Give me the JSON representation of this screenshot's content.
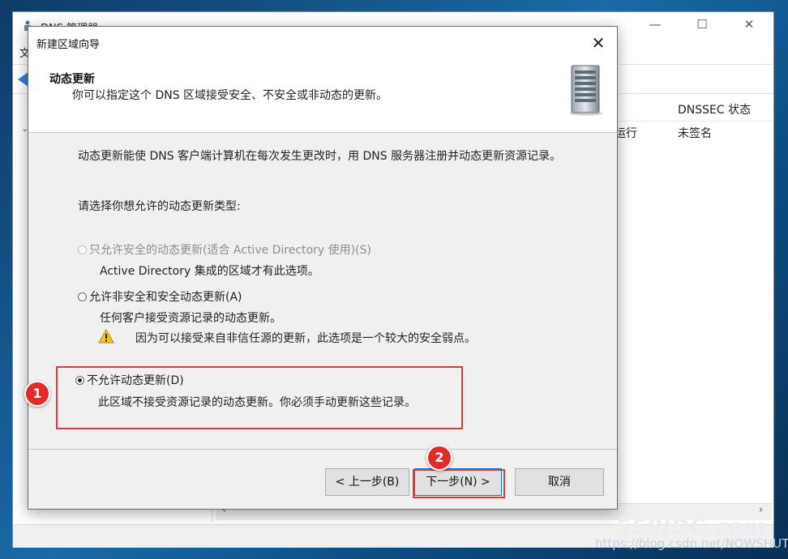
{
  "background_window": {
    "title": "DNS 管理器",
    "menu_first": "文",
    "column_dnssec": "DNSSEC 状态",
    "cell_status": "运行",
    "cell_dnssec": "未签名",
    "controls": {
      "minimize": "—",
      "maximize": "☐",
      "close": "✕"
    },
    "scroll_left": "‹",
    "scroll_right": "›",
    "tree_expand": "⌄"
  },
  "dialog": {
    "title": "新建区域向导",
    "close": "✕",
    "header": {
      "title": "动态更新",
      "subtitle": "你可以指定这个 DNS 区域接受安全、不安全或非动态的更新。"
    },
    "intro": "动态更新能使 DNS 客户端计算机在每次发生更改时，用 DNS 服务器注册并动态更新资源记录。",
    "prompt": "请选择你想允许的动态更新类型:",
    "options": [
      {
        "label": "只允许安全的动态更新(适合 Active Directory 使用)(S)",
        "desc": "Active Directory 集成的区域才有此选项。",
        "state": "disabled"
      },
      {
        "label": "允许非安全和安全动态更新(A)",
        "desc": "任何客户接受资源记录的动态更新。",
        "warning": "因为可以接受来自非信任源的更新，此选项是一个较大的安全弱点。",
        "state": "unchecked"
      },
      {
        "label": "不允许动态更新(D)",
        "desc": "此区域不接受资源记录的动态更新。你必须手动更新这些记录。",
        "state": "checked"
      }
    ],
    "buttons": {
      "back": "< 上一步(B)",
      "next": "下一步(N) >",
      "cancel": "取消"
    }
  },
  "annotations": {
    "badge1": "1",
    "badge2": "2"
  },
  "watermark": {
    "logo": "558IDC.com",
    "url": "https://blog.csdn.net/NOWSHUT"
  },
  "colors": {
    "highlight": "#e53935",
    "badge": "#e02b2b",
    "accent": "#0078d7"
  },
  "icons": {
    "warning": "warning-icon",
    "server": "server-icon",
    "back": "back-arrow-icon"
  }
}
